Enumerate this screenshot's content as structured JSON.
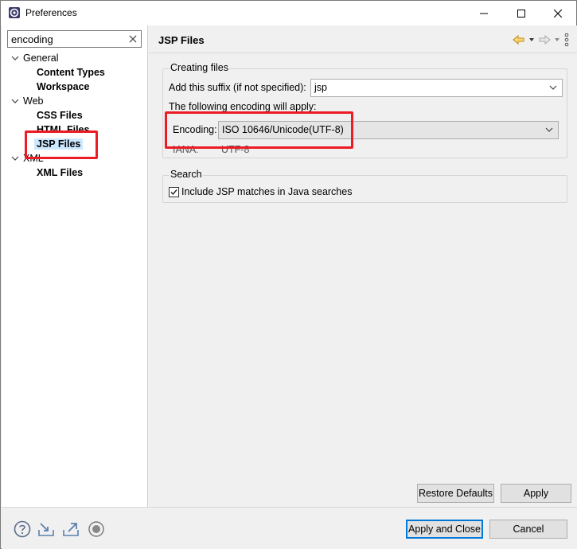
{
  "window": {
    "title": "Preferences"
  },
  "filter": {
    "value": "encoding"
  },
  "tree": {
    "general": {
      "label": "General",
      "children": [
        "Content Types",
        "Workspace"
      ]
    },
    "web": {
      "label": "Web",
      "children": [
        "CSS Files",
        "HTML Files",
        "JSP Files"
      ]
    },
    "xml": {
      "label": "XML",
      "children": [
        "XML Files"
      ]
    },
    "selected": "JSP Files"
  },
  "page": {
    "title": "JSP Files",
    "creating_files": {
      "label": "Creating files",
      "suffix_label": "Add this suffix (if not specified):",
      "suffix_value": "jsp",
      "encoding_note": "The following encoding will apply:",
      "encoding_label": "Encoding:",
      "encoding_value": "ISO 10646/Unicode(UTF-8)",
      "iana_label": "IANA:",
      "iana_value": "UTF-8"
    },
    "search": {
      "label": "Search",
      "checkbox_label": "Include JSP matches in Java searches",
      "checked": true
    },
    "restore_defaults_label": "Restore Defaults",
    "apply_label": "Apply"
  },
  "footer": {
    "apply_close_label": "Apply and Close",
    "cancel_label": "Cancel"
  },
  "colors": {
    "highlight": "#ec1c24",
    "selection": "#cce8ff",
    "accent": "#0078d7",
    "nav_arrow": "#e8a317"
  },
  "icons": [
    "preferences-app-icon",
    "minimize-icon",
    "maximize-icon",
    "close-icon",
    "clear-filter-icon",
    "back-arrow-icon",
    "forward-arrow-icon",
    "view-menu-icon",
    "help-icon",
    "import-icon",
    "export-icon",
    "record-icon"
  ]
}
